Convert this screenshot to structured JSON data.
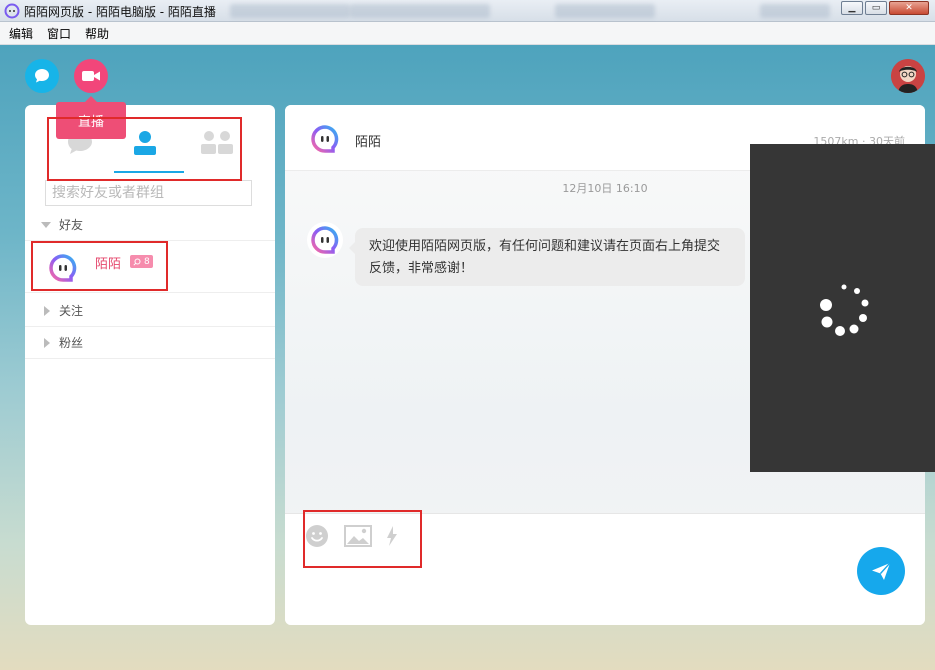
{
  "window": {
    "title": "陌陌网页版 - 陌陌电脑版 - 陌陌直播",
    "controls": {
      "minimize": "▁",
      "restore": "▭",
      "close": "✕"
    }
  },
  "menu": [
    "编辑",
    "窗口",
    "帮助"
  ],
  "top": {
    "tooltip": "直播",
    "icons": [
      "chat-bubble-icon",
      "video-camera-icon",
      "user-avatar"
    ]
  },
  "sidebar": {
    "tabs": [
      {
        "name": "chat",
        "icon": "chat-icon",
        "active": false
      },
      {
        "name": "contacts",
        "icon": "contact-icon",
        "active": true
      },
      {
        "name": "groups",
        "icon": "groups-icon",
        "active": false
      }
    ],
    "search_placeholder": "搜索好友或者群组",
    "groups": {
      "friends": "好友",
      "following": "关注",
      "fans": "粉丝"
    },
    "friend": {
      "name": "陌陌",
      "badge": "8"
    }
  },
  "chat": {
    "title": "陌陌",
    "meta": "1507km · 30天前",
    "timestamp": "12月10日 16:10",
    "message": "欢迎使用陌陌网页版，有任何问题和建议请在页面右上角提交反馈，非常感谢！",
    "tools": [
      "emoji-icon",
      "image-icon",
      "flash-icon"
    ],
    "send_icon": "send-icon"
  },
  "colors": {
    "accent_blue": "#1aa7e5",
    "accent_pink": "#ee4e76",
    "annotation_red": "#e02a2a"
  }
}
